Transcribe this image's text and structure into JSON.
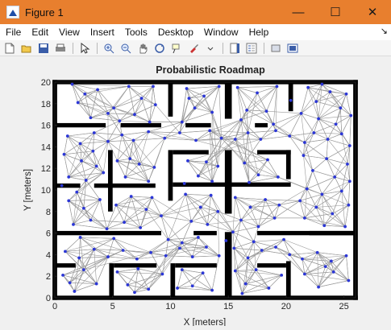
{
  "window": {
    "title": "Figure 1",
    "minimize_glyph": "—",
    "maximize_glyph": "☐",
    "close_glyph": "✕",
    "titlebar_color": "#e87f2e"
  },
  "menu": {
    "items": [
      "File",
      "Edit",
      "View",
      "Insert",
      "Tools",
      "Desktop",
      "Window",
      "Help"
    ],
    "overflow_glyph": "↘"
  },
  "toolbar": {
    "icons": [
      "new-figure-icon",
      "open-file-icon",
      "save-icon",
      "print-icon",
      "pointer-icon",
      "zoom-in-icon",
      "zoom-out-icon",
      "pan-icon",
      "rotate-3d-icon",
      "data-cursor-icon",
      "brush-icon",
      "link-plot-icon",
      "colorbar-icon",
      "legend-icon",
      "hide-plot-tools-icon",
      "show-plot-tools-icon"
    ]
  },
  "chart_data": {
    "type": "scatter",
    "title": "Probabilistic Roadmap",
    "xlabel": "X [meters]",
    "ylabel": "Y [meters]",
    "xlim": [
      0,
      26
    ],
    "ylim": [
      0,
      20
    ],
    "xticks": [
      "0",
      "5",
      "10",
      "15",
      "20",
      "25"
    ],
    "yticks": [
      "0",
      "2",
      "4",
      "6",
      "8",
      "10",
      "12",
      "14",
      "16",
      "18",
      "20"
    ],
    "node_color": "#2b36d6",
    "edge_color": "#9a9a9a",
    "wall_color": "#000000",
    "nodes": [
      [
        1.5,
        19.8
      ],
      [
        2.6,
        18.9
      ],
      [
        3.7,
        19.3
      ],
      [
        5.1,
        17.6
      ],
      [
        6.4,
        19.6
      ],
      [
        7.5,
        18.5
      ],
      [
        8.2,
        16.3
      ],
      [
        8.7,
        17.9
      ],
      [
        3.1,
        16.7
      ],
      [
        4.6,
        17.1
      ],
      [
        2.0,
        18.1
      ],
      [
        6.9,
        17.0
      ],
      [
        8.5,
        19.6
      ],
      [
        5.6,
        16.4
      ],
      [
        1.1,
        15.0
      ],
      [
        2.2,
        14.3
      ],
      [
        3.4,
        15.3
      ],
      [
        4.6,
        14.5
      ],
      [
        5.8,
        15.1
      ],
      [
        6.8,
        14.6
      ],
      [
        8.1,
        15.4
      ],
      [
        9.5,
        14.8
      ],
      [
        10.8,
        15.3
      ],
      [
        12.2,
        14.6
      ],
      [
        13.4,
        15.5
      ],
      [
        14.4,
        14.8
      ],
      [
        15.6,
        14.7
      ],
      [
        16.7,
        15.3
      ],
      [
        17.8,
        14.7
      ],
      [
        19.1,
        15.5
      ],
      [
        20.3,
        15.0
      ],
      [
        21.6,
        14.4
      ],
      [
        22.4,
        15.3
      ],
      [
        23.6,
        14.7
      ],
      [
        24.8,
        15.2
      ],
      [
        25.5,
        14.1
      ],
      [
        0.8,
        13.3
      ],
      [
        2.3,
        12.7
      ],
      [
        3.3,
        13.6
      ],
      [
        1.2,
        11.2
      ],
      [
        2.7,
        10.9
      ],
      [
        3.6,
        12.2
      ],
      [
        1.9,
        9.8
      ],
      [
        4.2,
        11.6
      ],
      [
        0.6,
        10.4
      ],
      [
        11.4,
        19.4
      ],
      [
        12.1,
        17.6
      ],
      [
        11.0,
        16.3
      ],
      [
        12.9,
        18.7
      ],
      [
        13.6,
        17.2
      ],
      [
        14.2,
        19.6
      ],
      [
        11.6,
        18.5
      ],
      [
        15.8,
        19.5
      ],
      [
        16.6,
        17.4
      ],
      [
        17.5,
        19.0
      ],
      [
        18.3,
        17.3
      ],
      [
        19.2,
        19.6
      ],
      [
        20.4,
        18.3
      ],
      [
        21.3,
        17.1
      ],
      [
        16.1,
        16.5
      ],
      [
        18.9,
        16.1
      ],
      [
        21.9,
        19.5
      ],
      [
        22.6,
        18.2
      ],
      [
        23.8,
        19.1
      ],
      [
        24.7,
        17.6
      ],
      [
        25.2,
        18.9
      ],
      [
        22.8,
        16.6
      ],
      [
        24.3,
        16.1
      ],
      [
        25.6,
        16.9
      ],
      [
        23.1,
        19.8
      ],
      [
        5.4,
        12.7
      ],
      [
        6.1,
        11.2
      ],
      [
        7.3,
        12.4
      ],
      [
        8.1,
        10.8
      ],
      [
        6.5,
        12.9
      ],
      [
        8.6,
        12.1
      ],
      [
        11.5,
        12.7
      ],
      [
        12.4,
        11.3
      ],
      [
        13.1,
        12.6
      ],
      [
        11.2,
        10.6
      ],
      [
        13.6,
        10.8
      ],
      [
        14.1,
        12.2
      ],
      [
        16.4,
        12.5
      ],
      [
        17.6,
        11.4
      ],
      [
        18.4,
        12.8
      ],
      [
        19.3,
        11.2
      ],
      [
        16.8,
        10.7
      ],
      [
        21.5,
        13.2
      ],
      [
        22.3,
        11.8
      ],
      [
        23.5,
        12.9
      ],
      [
        24.2,
        11.2
      ],
      [
        25.3,
        12.4
      ],
      [
        21.8,
        10.1
      ],
      [
        23.1,
        9.6
      ],
      [
        24.8,
        9.9
      ],
      [
        25.5,
        10.8
      ],
      [
        22.6,
        8.4
      ],
      [
        24.0,
        7.8
      ],
      [
        25.4,
        8.6
      ],
      [
        21.6,
        7.4
      ],
      [
        23.3,
        6.7
      ],
      [
        25.1,
        6.6
      ],
      [
        21.2,
        9.0
      ],
      [
        1.2,
        9.0
      ],
      [
        2.5,
        8.3
      ],
      [
        3.9,
        9.1
      ],
      [
        5.3,
        8.6
      ],
      [
        6.6,
        9.4
      ],
      [
        7.9,
        8.2
      ],
      [
        9.2,
        7.6
      ],
      [
        8.4,
        9.3
      ],
      [
        1.6,
        6.8
      ],
      [
        3.1,
        7.2
      ],
      [
        4.5,
        6.4
      ],
      [
        6.0,
        7.0
      ],
      [
        7.4,
        6.5
      ],
      [
        2.2,
        5.6
      ],
      [
        5.1,
        5.5
      ],
      [
        11.3,
        9.6
      ],
      [
        12.6,
        8.4
      ],
      [
        13.5,
        9.5
      ],
      [
        11.8,
        7.1
      ],
      [
        13.2,
        6.8
      ],
      [
        14.1,
        8.0
      ],
      [
        15.6,
        9.3
      ],
      [
        16.9,
        8.4
      ],
      [
        18.2,
        9.1
      ],
      [
        19.4,
        8.6
      ],
      [
        16.1,
        7.2
      ],
      [
        17.6,
        6.6
      ],
      [
        19.0,
        7.4
      ],
      [
        15.4,
        6.1
      ],
      [
        0.9,
        4.3
      ],
      [
        2.1,
        3.7
      ],
      [
        3.4,
        4.5
      ],
      [
        4.6,
        3.8
      ],
      [
        5.9,
        4.4
      ],
      [
        7.1,
        3.6
      ],
      [
        8.3,
        4.2
      ],
      [
        9.6,
        3.9
      ],
      [
        10.8,
        4.6
      ],
      [
        11.9,
        3.8
      ],
      [
        13.1,
        4.7
      ],
      [
        14.2,
        3.9
      ],
      [
        15.5,
        4.6
      ],
      [
        16.7,
        3.7
      ],
      [
        17.9,
        4.4
      ],
      [
        19.1,
        4.7
      ],
      [
        20.3,
        4.0
      ],
      [
        21.4,
        3.6
      ],
      [
        22.7,
        4.2
      ],
      [
        23.9,
        3.4
      ],
      [
        25.2,
        3.9
      ],
      [
        9.8,
        5.4
      ],
      [
        11.0,
        5.1
      ],
      [
        12.4,
        5.6
      ],
      [
        14.8,
        5.3
      ],
      [
        17.2,
        5.2
      ],
      [
        19.8,
        5.4
      ],
      [
        0.7,
        2.1
      ],
      [
        1.7,
        0.6
      ],
      [
        2.5,
        2.6
      ],
      [
        3.6,
        1.3
      ],
      [
        1.3,
        1.4
      ],
      [
        5.4,
        2.4
      ],
      [
        6.3,
        1.2
      ],
      [
        7.2,
        2.7
      ],
      [
        8.1,
        0.8
      ],
      [
        9.3,
        2.2
      ],
      [
        6.9,
        0.5
      ],
      [
        11.0,
        2.6
      ],
      [
        11.9,
        1.1
      ],
      [
        12.8,
        2.3
      ],
      [
        13.6,
        0.7
      ],
      [
        10.6,
        0.9
      ],
      [
        15.6,
        2.5
      ],
      [
        16.5,
        1.3
      ],
      [
        17.4,
        2.6
      ],
      [
        18.5,
        0.9
      ],
      [
        19.6,
        2.1
      ],
      [
        16.2,
        0.4
      ],
      [
        21.6,
        2.2
      ],
      [
        22.8,
        1.0
      ],
      [
        24.1,
        2.4
      ],
      [
        25.4,
        1.6
      ],
      [
        23.4,
        2.9
      ]
    ],
    "walls": [
      [
        [
          -0.2,
          -0.2
        ],
        [
          26.2,
          0.2
        ]
      ],
      [
        [
          -0.2,
          19.8
        ],
        [
          26.2,
          20.2
        ]
      ],
      [
        [
          -0.2,
          -0.2
        ],
        [
          0.2,
          20.2
        ]
      ],
      [
        [
          25.8,
          -0.2
        ],
        [
          26.2,
          20.2
        ]
      ],
      [
        [
          9.8,
          16.8
        ],
        [
          10.2,
          20.0
        ]
      ],
      [
        [
          14.7,
          16.6
        ],
        [
          15.3,
          20.0
        ]
      ],
      [
        [
          20.2,
          17.3
        ],
        [
          20.6,
          20.0
        ]
      ],
      [
        [
          0.0,
          15.8
        ],
        [
          4.4,
          16.2
        ]
      ],
      [
        [
          5.7,
          15.8
        ],
        [
          9.2,
          16.2
        ]
      ],
      [
        [
          11.3,
          15.8
        ],
        [
          13.5,
          16.2
        ]
      ],
      [
        [
          17.3,
          15.8
        ],
        [
          18.4,
          16.2
        ]
      ],
      [
        [
          4.6,
          8.0
        ],
        [
          5.0,
          13.7
        ]
      ],
      [
        [
          0.0,
          10.2
        ],
        [
          2.2,
          10.6
        ]
      ],
      [
        [
          3.4,
          10.2
        ],
        [
          8.7,
          10.6
        ]
      ],
      [
        [
          9.8,
          9.0
        ],
        [
          10.2,
          13.7
        ]
      ],
      [
        [
          10.2,
          13.3
        ],
        [
          13.3,
          13.7
        ]
      ],
      [
        [
          14.7,
          7.8
        ],
        [
          15.3,
          13.7
        ]
      ],
      [
        [
          20.0,
          11.0
        ],
        [
          20.4,
          13.7
        ]
      ],
      [
        [
          17.5,
          13.3
        ],
        [
          20.4,
          13.7
        ]
      ],
      [
        [
          10.2,
          10.3
        ],
        [
          20.4,
          10.7
        ]
      ],
      [
        [
          0.0,
          5.8
        ],
        [
          9.2,
          6.2
        ]
      ],
      [
        [
          12.0,
          5.8
        ],
        [
          14.0,
          6.2
        ]
      ],
      [
        [
          17.5,
          5.8
        ],
        [
          26.0,
          6.2
        ]
      ],
      [
        [
          14.7,
          0.0
        ],
        [
          15.3,
          6.1
        ]
      ],
      [
        [
          4.7,
          0.0
        ],
        [
          5.1,
          3.2
        ]
      ],
      [
        [
          10.0,
          0.0
        ],
        [
          10.4,
          3.2
        ]
      ],
      [
        [
          10.4,
          2.8
        ],
        [
          14.0,
          3.2
        ]
      ],
      [
        [
          5.1,
          2.8
        ],
        [
          8.8,
          3.2
        ]
      ],
      [
        [
          0.0,
          2.8
        ],
        [
          1.8,
          3.2
        ]
      ],
      [
        [
          20.0,
          0.0
        ],
        [
          20.4,
          3.4
        ]
      ],
      [
        [
          17.5,
          2.8
        ],
        [
          20.0,
          3.2
        ]
      ],
      [
        [
          22.0,
          5.8
        ],
        [
          26.0,
          6.2
        ]
      ]
    ]
  }
}
